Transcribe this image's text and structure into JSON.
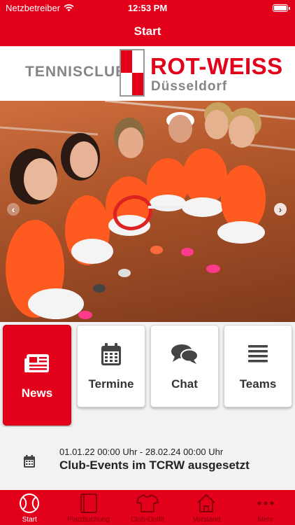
{
  "status_bar": {
    "carrier": "Netzbetreiber",
    "time": "12:53 PM"
  },
  "nav": {
    "title": "Start"
  },
  "logo": {
    "club_word": "TENNISCLUB",
    "brand": "ROT-WEISS",
    "city": "Düsseldorf"
  },
  "tiles": [
    {
      "label": "News",
      "icon": "newspaper-icon"
    },
    {
      "label": "Termine",
      "icon": "calendar-icon"
    },
    {
      "label": "Chat",
      "icon": "chat-bubbles-icon"
    },
    {
      "label": "Teams",
      "icon": "list-icon"
    }
  ],
  "event": {
    "date": "01.01.22 00:00 Uhr - 28.02.24 00:00 Uhr",
    "title": "Club-Events im TCRW ausgesetzt"
  },
  "tabbar": [
    {
      "label": "Start",
      "icon": "tennis-ball-icon"
    },
    {
      "label": "Platzbuchung",
      "icon": "book-icon"
    },
    {
      "label": "Club-Outfit",
      "icon": "shirt-icon"
    },
    {
      "label": "Vorstand",
      "icon": "house-icon"
    },
    {
      "label": "Mehr",
      "icon": "more-dots-icon"
    }
  ],
  "colors": {
    "brand_red": "#e2001a",
    "grey_text": "#858585",
    "background": "#f2f2f2"
  }
}
